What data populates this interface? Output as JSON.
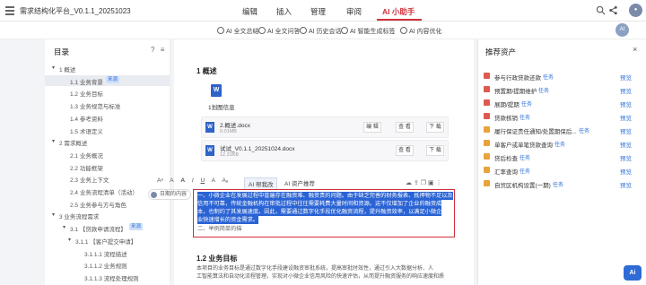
{
  "app": {
    "title": "需求结构化平台_V0.1.1_20251023",
    "menu": [
      "编辑",
      "插入",
      "管理",
      "审阅",
      "AI 小助手"
    ],
    "active_menu": "AI 小助手"
  },
  "ai_toolbar": {
    "buttons": [
      "AI 全文总结",
      "AI 全文问答",
      "AI 历史会话",
      "AI 智能生成标签",
      "AI 内容优化"
    ],
    "avatar_text": "AI"
  },
  "outline": {
    "title": "目录",
    "items": [
      {
        "label": "1 概述",
        "level": 1,
        "caret": "▾"
      },
      {
        "label": "1.1 业务背景",
        "level": 2,
        "tag": "来源",
        "selected": true
      },
      {
        "label": "1.2 业务目标",
        "level": 2
      },
      {
        "label": "1.3 业务规范与标准",
        "level": 2
      },
      {
        "label": "1.4 参考资料",
        "level": 2
      },
      {
        "label": "1.5 术语定义",
        "level": 2
      },
      {
        "label": "2 需求概述",
        "level": 1,
        "caret": "▾"
      },
      {
        "label": "2.1 业务概况",
        "level": 2
      },
      {
        "label": "2.2 功能框架",
        "level": 2
      },
      {
        "label": "2.3 业务上下文",
        "level": 2
      },
      {
        "label": "2.4 业务流程清单（活动）",
        "level": 2
      },
      {
        "label": "2.5 业务参与方与角色",
        "level": 2
      },
      {
        "label": "3 业务流程需求",
        "level": 1,
        "caret": "▾"
      },
      {
        "label": "3.1 【贷款申请流程】",
        "level": 2,
        "caret": "▾",
        "tag": "来源"
      },
      {
        "label": "3.1.1 【客户提交申请】",
        "level": 3,
        "caret": "▾"
      },
      {
        "label": "3.1.1.1 流程描述",
        "level": 4
      },
      {
        "label": "3.1.1.2 业务规则",
        "level": 4
      },
      {
        "label": "3.1.1.3 流程处理规则",
        "level": 4
      }
    ]
  },
  "document": {
    "heading1": "1 概述",
    "word_caption": "1划图信息",
    "files": [
      {
        "name": "2.概述.docx",
        "size": "0.01MB",
        "buttons": [
          "编 辑",
          "查 看",
          "下 载"
        ]
      },
      {
        "name": "试试_V0.1.1_20251024.docx",
        "size": "12.31KB",
        "buttons": [
          "查 看",
          "下 载"
        ]
      }
    ],
    "edit_toolbar": [
      "Aᵃ",
      "A",
      "A",
      "I",
      "U",
      "A",
      "Aₐ"
    ],
    "ai_pills": [
      "AI 帮我改",
      "AI 资产推荐"
    ],
    "side_handle": "日期的内容",
    "selection_lines": [
      "一、小微企业在发展过程中普遍存在融资难、融资贵的问题。由于缺乏完善的财务报表、抵押物不足以及",
      "信用不可靠，传统金融机构在审批过程中往往需要耗费大量时间和资源。这不仅增加了企业的融资成",
      "本，也制约了其发展速度。因此，需要通过数字化手段优化融资流程，提升融资效率，以满足小微企",
      "业快速增长的资金需求。",
      "二、举例简单的描"
    ],
    "heading2": "1.2 业务目标",
    "paragraph": [
      "本项目的业务目标是通过数字化手段建设融资审批系统，提高审批时效性，通过引入大数据分析、人",
      "工智能算法和自动化流程管理，实现对小微企业信用风险的快速评估，从而提升融资服务的响应速度和质"
    ]
  },
  "resources": {
    "title": "推荐资产",
    "close": "×",
    "items": [
      {
        "label": "参与行政贷款还款",
        "tag": "任务",
        "preview": "预览",
        "color": "#e0594f"
      },
      {
        "label": "预置期/提期维护",
        "tag": "任务",
        "preview": "预览",
        "color": "#e0594f"
      },
      {
        "label": "展期/提期",
        "tag": "任务",
        "preview": "预览",
        "color": "#e0594f"
      },
      {
        "label": "贷款核销",
        "tag": "任务",
        "preview": "预览",
        "color": "#e0594f"
      },
      {
        "label": "履行保证责任通知/处置期保后...",
        "tag": "任务",
        "preview": "预览",
        "color": "#e8a33b"
      },
      {
        "label": "单客户或单笔贷款查询",
        "tag": "任务",
        "preview": "预览",
        "color": "#e8a33b"
      },
      {
        "label": "贷后检查",
        "tag": "任务",
        "preview": "预览",
        "color": "#e8a33b"
      },
      {
        "label": "汇率查询",
        "tag": "任务",
        "preview": "预览",
        "color": "#e8a33b"
      },
      {
        "label": "自贸区机构设置(一期)",
        "tag": "任务",
        "preview": "预览",
        "color": "#e8a33b"
      }
    ]
  },
  "floating": {
    "ai_label": "Ai"
  },
  "colors": {
    "accent": "#d0313b",
    "link": "#3576d8",
    "highlight": "#2a63d4"
  }
}
